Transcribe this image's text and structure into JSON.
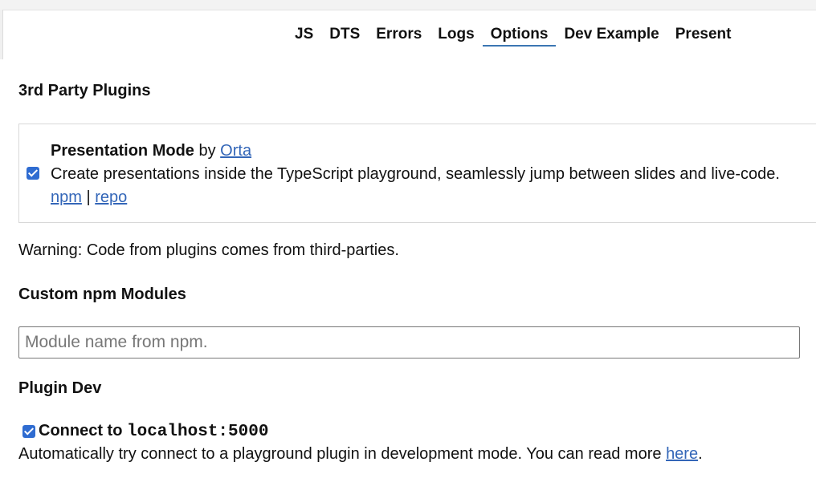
{
  "tabs": [
    {
      "label": "JS"
    },
    {
      "label": "DTS"
    },
    {
      "label": "Errors"
    },
    {
      "label": "Logs"
    },
    {
      "label": "Options",
      "active": true
    },
    {
      "label": "Dev Example"
    },
    {
      "label": "Present"
    }
  ],
  "third_party": {
    "heading": "3rd Party Plugins",
    "plugin": {
      "checked": true,
      "name": "Presentation Mode",
      "by": "by",
      "author": "Orta",
      "description": "Create presentations inside the TypeScript playground, seamlessly jump between slides and live-code.",
      "npm_link": "npm",
      "separator": "|",
      "repo_link": "repo"
    },
    "warning": "Warning: Code from plugins comes from third-parties."
  },
  "custom_modules": {
    "heading": "Custom npm Modules",
    "placeholder": "Module name from npm.",
    "value": ""
  },
  "plugin_dev": {
    "heading": "Plugin Dev",
    "checked": true,
    "label_prefix": "Connect to",
    "label_code": "localhost:5000",
    "description": "Automatically try connect to a playground plugin in development mode. You can read more",
    "link": "here",
    "suffix": "."
  },
  "colors": {
    "accent": "#2f6cd1",
    "link": "#3366b8"
  }
}
